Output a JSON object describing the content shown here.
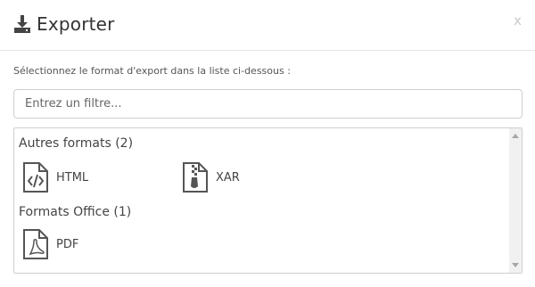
{
  "dialog": {
    "title": "Exporter",
    "title_icon": "download-icon",
    "close_label": "x"
  },
  "instructions": "Sélectionnez le format d'export dans la liste ci-dessous :",
  "filter": {
    "placeholder": "Entrez un filtre...",
    "value": ""
  },
  "groups": [
    {
      "title": "Autres formats (2)",
      "items": [
        {
          "label": "HTML",
          "icon": "html-file-icon"
        },
        {
          "label": "XAR",
          "icon": "archive-file-icon"
        }
      ]
    },
    {
      "title": "Formats Office (1)",
      "items": [
        {
          "label": "PDF",
          "icon": "pdf-file-icon"
        }
      ]
    }
  ],
  "colors": {
    "text": "#333333",
    "border": "#cfcfcf",
    "icon": "#555555"
  }
}
